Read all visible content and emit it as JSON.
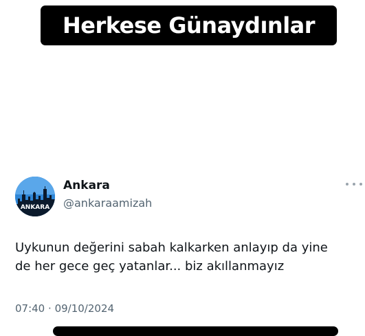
{
  "banner": {
    "text": "Herkese Günaydınlar"
  },
  "tweet": {
    "avatar_text": "ANKARA",
    "display_name": "Ankara",
    "handle": "@ankaraamizah",
    "text_lines": [
      "Uykunun değerini sabah kalkarken anlayıp da yine",
      "de her gece geç yatanlar... biz akıllanmayız"
    ],
    "time": "07:40",
    "separator": "·",
    "date": "09/10/2024",
    "more_icon": "more-horizontal-icon"
  },
  "colors": {
    "banner_bg": "#000000",
    "banner_text": "#ffffff",
    "primary_text": "#0f1419",
    "secondary_text": "#536471",
    "avatar_bg": "#2f86d6"
  }
}
